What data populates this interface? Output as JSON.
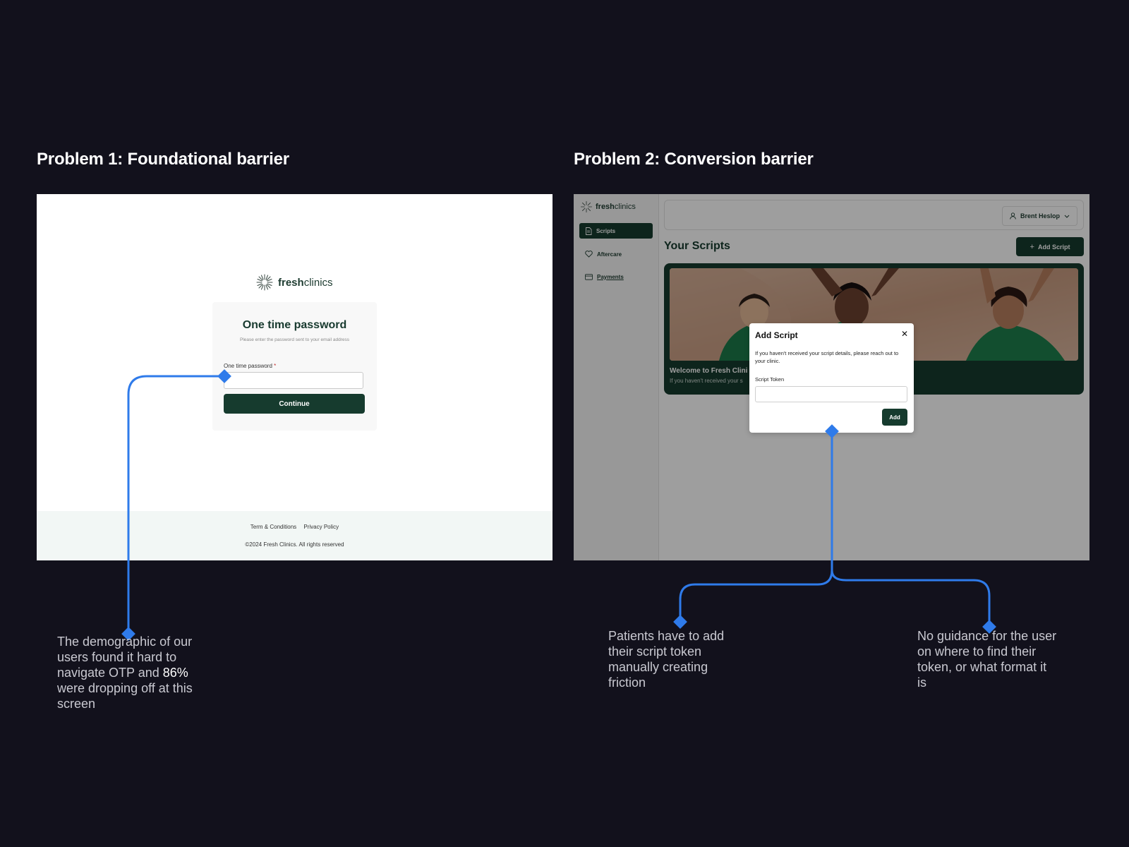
{
  "headings": {
    "problem1": "Problem 1: Foundational barrier",
    "problem2": "Problem 2: Conversion barrier"
  },
  "panel1": {
    "logo": {
      "bold": "fresh",
      "regular": "clinics"
    },
    "otp_card": {
      "title": "One time password",
      "subtitle": "Please enter the password sent to your email address",
      "field_label": "One time password",
      "required_mark": "*",
      "input_value": "",
      "continue_label": "Continue"
    },
    "footer": {
      "terms": "Term & Conditions",
      "privacy": "Privacy Policy",
      "copyright": "©2024 Fresh Clinics. All rights reserved"
    }
  },
  "panel2": {
    "logo": {
      "bold": "fresh",
      "regular": "clinics"
    },
    "sidebar": {
      "items": [
        {
          "label": "Scripts",
          "icon": "document-icon",
          "active": true
        },
        {
          "label": "Aftercare",
          "icon": "heart-icon",
          "active": false
        },
        {
          "label": "Payments",
          "icon": "credit-card-icon",
          "active": false
        }
      ]
    },
    "user_menu": {
      "name": "Brent Heslop"
    },
    "page_title": "Your Scripts",
    "add_script_button": "Add Script",
    "welcome_card": {
      "title": "Welcome to Fresh Clini",
      "subtitle": "If you haven't received your s"
    },
    "modal": {
      "title": "Add Script",
      "close_glyph": "✕",
      "description": "If you haven't received your script details, please reach out to your clinic.",
      "field_label": "Script Token",
      "input_value": "",
      "add_label": "Add"
    }
  },
  "annotations": {
    "a1_pre": "The demographic of our users found it hard to navigate OTP and ",
    "a1_highlight": "86%",
    "a1_post": " were dropping off at this screen",
    "a2": "Patients have to add their script token manually creating friction",
    "a3": "No guidance for the user on where to find their token, or what format it is"
  },
  "colors": {
    "background": "#12111c",
    "brand_green": "#163b2e",
    "connector_blue": "#2f7bea"
  }
}
